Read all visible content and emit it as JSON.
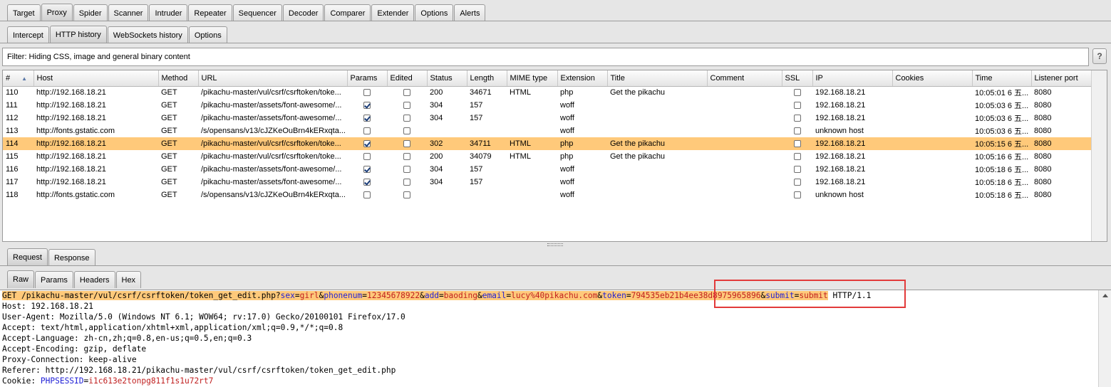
{
  "main_tabs": [
    "Target",
    "Proxy",
    "Spider",
    "Scanner",
    "Intruder",
    "Repeater",
    "Sequencer",
    "Decoder",
    "Comparer",
    "Extender",
    "Options",
    "Alerts"
  ],
  "proxy_tabs": [
    "Intercept",
    "HTTP history",
    "WebSockets history",
    "Options"
  ],
  "filter_text": "Filter:  Hiding CSS, image and general binary content",
  "help_label": "?",
  "columns": [
    "#",
    "Host",
    "Method",
    "URL",
    "Params",
    "Edited",
    "Status",
    "Length",
    "MIME type",
    "Extension",
    "Title",
    "Comment",
    "SSL",
    "IP",
    "Cookies",
    "Time",
    "Listener port"
  ],
  "rows": [
    {
      "num": "110",
      "host": "http://192.168.18.21",
      "method": "GET",
      "url": "/pikachu-master/vul/csrf/csrftoken/toke...",
      "params": false,
      "edited": false,
      "status": "200",
      "length": "34671",
      "mime": "HTML",
      "ext": "php",
      "title": "Get the pikachu",
      "comment": "",
      "ssl": false,
      "ip": "192.168.18.21",
      "cookies": "",
      "time": "10:05:01 6 五...",
      "port": "8080",
      "selected": false
    },
    {
      "num": "111",
      "host": "http://192.168.18.21",
      "method": "GET",
      "url": "/pikachu-master/assets/font-awesome/...",
      "params": true,
      "edited": false,
      "status": "304",
      "length": "157",
      "mime": "",
      "ext": "woff",
      "title": "",
      "comment": "",
      "ssl": false,
      "ip": "192.168.18.21",
      "cookies": "",
      "time": "10:05:03 6 五...",
      "port": "8080",
      "selected": false
    },
    {
      "num": "112",
      "host": "http://192.168.18.21",
      "method": "GET",
      "url": "/pikachu-master/assets/font-awesome/...",
      "params": true,
      "edited": false,
      "status": "304",
      "length": "157",
      "mime": "",
      "ext": "woff",
      "title": "",
      "comment": "",
      "ssl": false,
      "ip": "192.168.18.21",
      "cookies": "",
      "time": "10:05:03 6 五...",
      "port": "8080",
      "selected": false
    },
    {
      "num": "113",
      "host": "http://fonts.gstatic.com",
      "method": "GET",
      "url": "/s/opensans/v13/cJZKeOuBrn4kERxqta...",
      "params": false,
      "edited": false,
      "status": "",
      "length": "",
      "mime": "",
      "ext": "woff",
      "title": "",
      "comment": "",
      "ssl": false,
      "ip": "unknown host",
      "cookies": "",
      "time": "10:05:03 6 五...",
      "port": "8080",
      "selected": false
    },
    {
      "num": "114",
      "host": "http://192.168.18.21",
      "method": "GET",
      "url": "/pikachu-master/vul/csrf/csrftoken/toke...",
      "params": true,
      "edited": false,
      "status": "302",
      "length": "34711",
      "mime": "HTML",
      "ext": "php",
      "title": "Get the pikachu",
      "comment": "",
      "ssl": false,
      "ip": "192.168.18.21",
      "cookies": "",
      "time": "10:05:15 6 五...",
      "port": "8080",
      "selected": true
    },
    {
      "num": "115",
      "host": "http://192.168.18.21",
      "method": "GET",
      "url": "/pikachu-master/vul/csrf/csrftoken/toke...",
      "params": false,
      "edited": false,
      "status": "200",
      "length": "34079",
      "mime": "HTML",
      "ext": "php",
      "title": "Get the pikachu",
      "comment": "",
      "ssl": false,
      "ip": "192.168.18.21",
      "cookies": "",
      "time": "10:05:16 6 五...",
      "port": "8080",
      "selected": false
    },
    {
      "num": "116",
      "host": "http://192.168.18.21",
      "method": "GET",
      "url": "/pikachu-master/assets/font-awesome/...",
      "params": true,
      "edited": false,
      "status": "304",
      "length": "157",
      "mime": "",
      "ext": "woff",
      "title": "",
      "comment": "",
      "ssl": false,
      "ip": "192.168.18.21",
      "cookies": "",
      "time": "10:05:18 6 五...",
      "port": "8080",
      "selected": false
    },
    {
      "num": "117",
      "host": "http://192.168.18.21",
      "method": "GET",
      "url": "/pikachu-master/assets/font-awesome/...",
      "params": true,
      "edited": false,
      "status": "304",
      "length": "157",
      "mime": "",
      "ext": "woff",
      "title": "",
      "comment": "",
      "ssl": false,
      "ip": "192.168.18.21",
      "cookies": "",
      "time": "10:05:18 6 五...",
      "port": "8080",
      "selected": false
    },
    {
      "num": "118",
      "host": "http://fonts.gstatic.com",
      "method": "GET",
      "url": "/s/opensans/v13/cJZKeOuBrn4kERxqta...",
      "params": false,
      "edited": false,
      "status": "",
      "length": "",
      "mime": "",
      "ext": "woff",
      "title": "",
      "comment": "",
      "ssl": false,
      "ip": "unknown host",
      "cookies": "",
      "time": "10:05:18 6 五...",
      "port": "8080",
      "selected": false
    }
  ],
  "reqresp_tabs": [
    "Request",
    "Response"
  ],
  "raw_tabs": [
    "Raw",
    "Params",
    "Headers",
    "Hex"
  ],
  "request": {
    "method": "GET ",
    "path": "/pikachu-master/vul/csrf/csrftoken/token_get_edit.php?",
    "query": [
      {
        "name": "sex",
        "value": "girl"
      },
      {
        "name": "phonenum",
        "value": "12345678922"
      },
      {
        "name": "add",
        "value": "baoding"
      },
      {
        "name": "email",
        "value": "lucy%40pikachu.com"
      },
      {
        "name": "token",
        "value": "794535eb21b4ee38d8975965896"
      },
      {
        "name": "submit",
        "value": "submit"
      }
    ],
    "version": " HTTP/1.1",
    "headers": [
      "Host: 192.168.18.21",
      "User-Agent: Mozilla/5.0 (Windows NT 6.1; WOW64; rv:17.0) Gecko/20100101 Firefox/17.0",
      "Accept: text/html,application/xhtml+xml,application/xml;q=0.9,*/*;q=0.8",
      "Accept-Language: zh-cn,zh;q=0.8,en-us;q=0.5,en;q=0.3",
      "Accept-Encoding: gzip, deflate",
      "Proxy-Connection: keep-alive",
      "Referer: http://192.168.18.21/pikachu-master/vul/csrf/csrftoken/token_get_edit.php"
    ],
    "cookie_prefix": "Cookie: ",
    "cookie_name": "PHPSESSID",
    "cookie_value": "i1c613e2tonpg811f1s1u72rt7"
  },
  "colors": {
    "selected_row": "#ffc97a",
    "param_name": "#1f1fd6",
    "param_value": "#c02020",
    "annotation_box": "#e23a3a"
  }
}
